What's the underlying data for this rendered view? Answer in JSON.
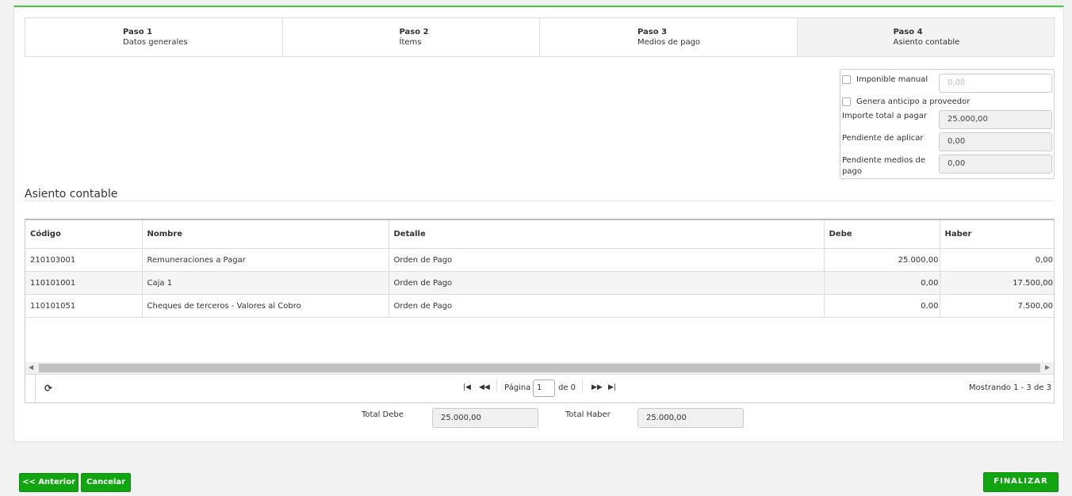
{
  "steps": [
    {
      "title": "Paso 1",
      "subtitle": "Datos generales"
    },
    {
      "title": "Paso 2",
      "subtitle": "Ítems"
    },
    {
      "title": "Paso 3",
      "subtitle": "Medios de pago"
    },
    {
      "title": "Paso 4",
      "subtitle": "Asiento contable"
    }
  ],
  "summary": {
    "imponible_manual_label": "Imponible manual",
    "imponible_manual_placeholder": "0,00",
    "anticipo_label": "Genera anticipo a proveedor",
    "importe_total_label": "Importe total a pagar",
    "importe_total_value": "25.000,00",
    "pendiente_aplicar_label": "Pendiente de aplicar",
    "pendiente_aplicar_value": "0,00",
    "pendiente_medios_label": "Pendiente medios de pago",
    "pendiente_medios_value": "0,00"
  },
  "section_title": "Asiento contable",
  "grid": {
    "columns": [
      "Código",
      "Nombre",
      "Detalle",
      "Debe",
      "Haber"
    ],
    "rows": [
      {
        "codigo": "210103001",
        "nombre": "Remuneraciones a Pagar",
        "detalle": "Orden de Pago",
        "debe": "25.000,00",
        "haber": "0,00"
      },
      {
        "codigo": "110101001",
        "nombre": "Caja 1",
        "detalle": "Orden de Pago",
        "debe": "0,00",
        "haber": "17.500,00"
      },
      {
        "codigo": "110101051",
        "nombre": "Cheques de terceros - Valores al Cobro",
        "detalle": "Orden de Pago",
        "debe": "0,00",
        "haber": "7.500,00"
      }
    ]
  },
  "pager": {
    "page_label": "Página",
    "page_value": "1",
    "of_label": "de 0",
    "showing": "Mostrando 1 - 3 de 3"
  },
  "totals": {
    "debe_label": "Total Debe",
    "debe_value": "25.000,00",
    "haber_label": "Total Haber",
    "haber_value": "25.000,00"
  },
  "buttons": {
    "prev": "<< Anterior",
    "cancel": "Cancelar",
    "finish": "FINALIZAR"
  }
}
